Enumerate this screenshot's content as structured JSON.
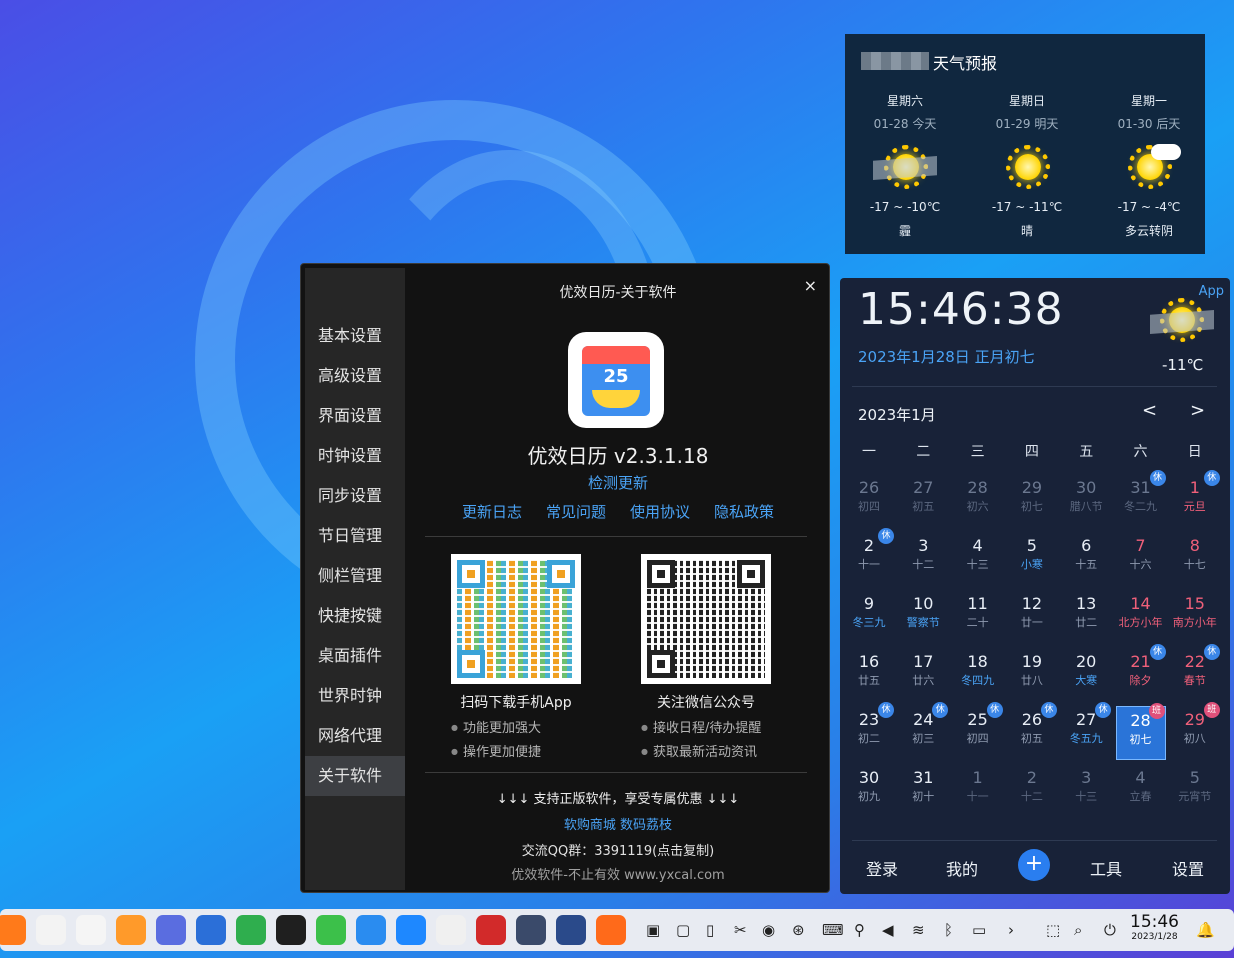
{
  "weather": {
    "title": "天气预报",
    "days": [
      {
        "name": "星期六",
        "date": "01-28 今天",
        "temp": "-17 ~ -10℃",
        "cond": "霾",
        "icon": "haze-sun-icon"
      },
      {
        "name": "星期日",
        "date": "01-29 明天",
        "temp": "-17 ~ -11℃",
        "cond": "晴",
        "icon": "sun-icon"
      },
      {
        "name": "星期一",
        "date": "01-30 后天",
        "temp": "-17 ~ -4℃",
        "cond": "多云转阴",
        "icon": "cloudy-sun-icon"
      }
    ]
  },
  "dialog": {
    "title": "优效日历-关于软件",
    "close": "×",
    "sidebar": [
      "基本设置",
      "高级设置",
      "界面设置",
      "时钟设置",
      "同步设置",
      "节日管理",
      "侧栏管理",
      "快捷按键",
      "桌面插件",
      "世界时钟",
      "网络代理",
      "关于软件"
    ],
    "active_index": 11,
    "app_icon_number": "25",
    "app_name": "优效日历 v2.3.1.18",
    "check_update": "检测更新",
    "links": [
      "更新日志",
      "常见问题",
      "使用协议",
      "隐私政策"
    ],
    "qr_left": {
      "caption": "扫码下载手机App",
      "bullets": [
        "功能更加强大",
        "操作更加便捷"
      ]
    },
    "qr_right": {
      "caption": "关注微信公众号",
      "bullets": [
        "接收日程/待办提醒",
        "获取最新活动资讯"
      ]
    },
    "support": "↓↓↓ 支持正版软件，享受专属优惠 ↓↓↓",
    "shop_links": "软购商城  数码荔枝",
    "qq_group": "交流QQ群：3391119(点击复制)",
    "footer": "优效软件-不止有效 www.yxcal.com"
  },
  "calendar": {
    "app_link": "App",
    "time": "15:46:38",
    "date": "2023年1月28日 正月初七",
    "temp": "-11℃",
    "month": "2023年1月",
    "prev": "<",
    "next": ">",
    "weekdays": [
      "一",
      "二",
      "三",
      "四",
      "五",
      "六",
      "日"
    ],
    "weeks": [
      [
        {
          "d": "26",
          "l": "初四",
          "dim": true
        },
        {
          "d": "27",
          "l": "初五",
          "dim": true
        },
        {
          "d": "28",
          "l": "初六",
          "dim": true
        },
        {
          "d": "29",
          "l": "初七",
          "dim": true
        },
        {
          "d": "30",
          "l": "腊八节",
          "dim": true
        },
        {
          "d": "31",
          "l": "冬二九",
          "dim": true,
          "badge": "休"
        },
        {
          "d": "1",
          "l": "元旦",
          "red": true,
          "lblue": true,
          "badge": "休"
        }
      ],
      [
        {
          "d": "2",
          "l": "十一",
          "badge": "休"
        },
        {
          "d": "3",
          "l": "十二"
        },
        {
          "d": "4",
          "l": "十三"
        },
        {
          "d": "5",
          "l": "小寒",
          "lblue": true
        },
        {
          "d": "6",
          "l": "十五"
        },
        {
          "d": "7",
          "l": "十六",
          "red": true
        },
        {
          "d": "8",
          "l": "十七",
          "red": true
        }
      ],
      [
        {
          "d": "9",
          "l": "冬三九",
          "lblue": true
        },
        {
          "d": "10",
          "l": "警察节",
          "lblue": true
        },
        {
          "d": "11",
          "l": "二十"
        },
        {
          "d": "12",
          "l": "廿一"
        },
        {
          "d": "13",
          "l": "廿二"
        },
        {
          "d": "14",
          "l": "北方小年",
          "red": true,
          "lblue": true
        },
        {
          "d": "15",
          "l": "南方小年",
          "red": true,
          "lblue": true
        }
      ],
      [
        {
          "d": "16",
          "l": "廿五"
        },
        {
          "d": "17",
          "l": "廿六"
        },
        {
          "d": "18",
          "l": "冬四九",
          "lblue": true
        },
        {
          "d": "19",
          "l": "廿八"
        },
        {
          "d": "20",
          "l": "大寒",
          "lblue": true
        },
        {
          "d": "21",
          "l": "除夕",
          "red": true,
          "lblue": true,
          "badge": "休"
        },
        {
          "d": "22",
          "l": "春节",
          "red": true,
          "lblue": true,
          "badge": "休"
        }
      ],
      [
        {
          "d": "23",
          "l": "初二",
          "badge": "休"
        },
        {
          "d": "24",
          "l": "初三",
          "badge": "休"
        },
        {
          "d": "25",
          "l": "初四",
          "badge": "休"
        },
        {
          "d": "26",
          "l": "初五",
          "badge": "休"
        },
        {
          "d": "27",
          "l": "冬五九",
          "lblue": true,
          "badge": "休"
        },
        {
          "d": "28",
          "l": "初七",
          "sel": true,
          "badge": "班",
          "ban": true
        },
        {
          "d": "29",
          "l": "初八",
          "red": true,
          "badge": "班",
          "ban": true
        }
      ],
      [
        {
          "d": "30",
          "l": "初九"
        },
        {
          "d": "31",
          "l": "初十"
        },
        {
          "d": "1",
          "l": "十一",
          "dim": true
        },
        {
          "d": "2",
          "l": "十二",
          "dim": true
        },
        {
          "d": "3",
          "l": "十三",
          "dim": true
        },
        {
          "d": "4",
          "l": "立春",
          "dim": true
        },
        {
          "d": "5",
          "l": "元宵节",
          "dim": true
        }
      ]
    ],
    "bottom": [
      "登录",
      "我的",
      "+",
      "工具",
      "设置"
    ]
  },
  "taskbar": {
    "apps": [
      "firefox-icon",
      "photos-icon",
      "paint-icon",
      "store-icon",
      "apps-grid-icon",
      "wps-icon",
      "evernote-icon",
      "calendar-icon",
      "wechat-icon",
      "feishu-icon",
      "dingtalk-icon",
      "clipboard-icon",
      "music-icon",
      "settings-icon",
      "monitor-icon",
      "firefox-icon-2"
    ],
    "clock_time": "15:46",
    "clock_date": "2023/1/28"
  }
}
